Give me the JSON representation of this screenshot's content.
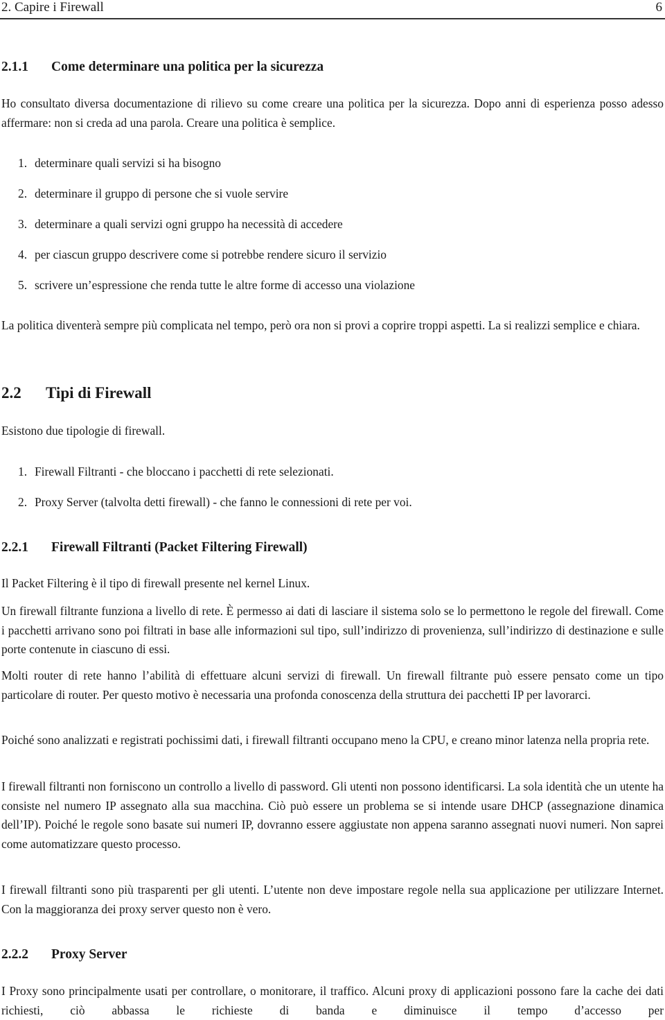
{
  "header": {
    "running_title": "2.  Capire i Firewall",
    "page_number": "6"
  },
  "s211": {
    "number": "2.1.1",
    "title": "Come determinare una politica per la sicurezza",
    "intro": "Ho consultato diversa documentazione di rilievo su come creare una politica per la sicurezza. Dopo anni di esperienza posso adesso affermare: non si creda ad una parola. Creare una politica è semplice.",
    "steps": [
      {
        "n": "1.",
        "text": "determinare quali servizi si ha bisogno"
      },
      {
        "n": "2.",
        "text": "determinare il gruppo di persone che si vuole servire"
      },
      {
        "n": "3.",
        "text": "determinare a quali servizi ogni gruppo ha necessità di accedere"
      },
      {
        "n": "4.",
        "text": "per ciascun gruppo descrivere come si potrebbe rendere sicuro il servizio"
      },
      {
        "n": "5.",
        "text": "scrivere un’espressione che renda tutte le altre forme di accesso una violazione"
      }
    ],
    "outro": "La politica diventerà sempre più complicata nel tempo, però ora non si provi a coprire troppi aspetti. La si realizzi semplice e chiara."
  },
  "s22": {
    "number": "2.2",
    "title": "Tipi di Firewall",
    "intro": "Esistono due tipologie di firewall.",
    "types": [
      {
        "n": "1.",
        "text": "Firewall Filtranti - che bloccano i pacchetti di rete selezionati."
      },
      {
        "n": "2.",
        "text": "Proxy Server (talvolta detti firewall) - che fanno le connessioni di rete per voi."
      }
    ]
  },
  "s221": {
    "number": "2.2.1",
    "title": "Firewall Filtranti (Packet Filtering Firewall)",
    "paragraphs": [
      "Il Packet Filtering è il tipo di firewall presente nel kernel Linux.",
      "Un firewall filtrante funziona a livello di rete. È permesso ai dati di lasciare il sistema solo se lo permettono le regole del firewall. Come i pacchetti arrivano sono poi filtrati in base alle informazioni sul tipo, sull’indirizzo di provenienza, sull’indirizzo di destinazione e sulle porte contenute in ciascuno di essi.",
      "Molti router di rete hanno l’abilità di effettuare alcuni servizi di firewall. Un firewall filtrante può essere pensato come un tipo particolare di router. Per questo motivo è necessaria una profonda conoscenza della struttura dei pacchetti IP per lavorarci.",
      "Poiché sono analizzati e registrati pochissimi dati, i firewall filtranti occupano meno la CPU, e creano minor latenza nella propria rete.",
      "I firewall filtranti non forniscono un controllo a livello di password. Gli utenti non possono identificarsi. La sola identità che un utente ha consiste nel numero IP assegnato alla sua macchina. Ciò può essere un problema se si intende usare DHCP (assegnazione dinamica dell’IP). Poiché le regole sono basate sui numeri IP, dovranno essere aggiustate non appena saranno assegnati nuovi numeri. Non saprei come automatizzare questo processo.",
      "I firewall filtranti sono più trasparenti per gli utenti. L’utente non deve impostare regole nella sua applicazione per utilizzare Internet. Con la maggioranza dei proxy server questo non è vero."
    ]
  },
  "s222": {
    "number": "2.2.2",
    "title": "Proxy Server",
    "paragraph": "I Proxy sono principalmente usati per controllare, o monitorare, il traffico. Alcuni proxy di applicazioni possono fare la cache dei dati richiesti, ciò abbassa le richieste di banda e diminuisce il tempo d’accesso per"
  }
}
